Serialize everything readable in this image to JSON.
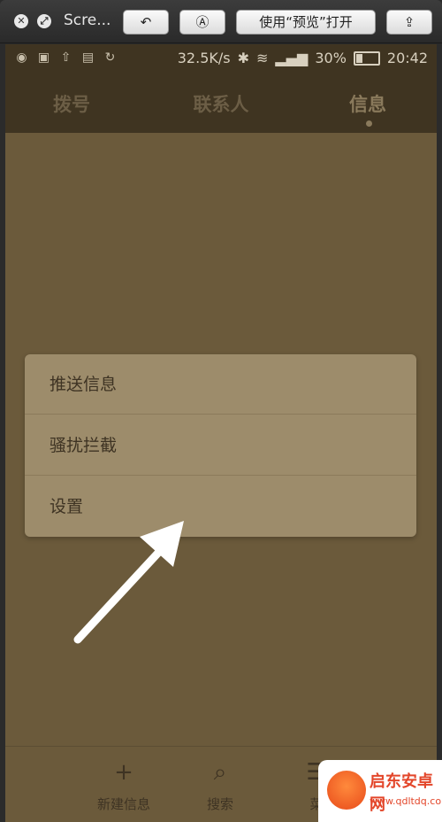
{
  "toolbar": {
    "title": "Scre...",
    "open_with_preview": "使用“预览”打开",
    "rotate_icon": "rotate-icon",
    "markup_icon": "markup-icon",
    "share_icon": "share-icon"
  },
  "statusbar": {
    "speed": "32.5K/s",
    "battery": "30%",
    "time": "20:42",
    "battery_level": 0.3
  },
  "tabs": [
    "拨号",
    "联系人",
    "信息"
  ],
  "active_tab": "信息",
  "menu": {
    "items": [
      "推送信息",
      "骚扰拦截",
      "设置"
    ]
  },
  "bottom_bar": {
    "items": [
      {
        "label": "新建信息",
        "icon": "plus-icon"
      },
      {
        "label": "搜索",
        "icon": "search-icon"
      },
      {
        "label": "菜",
        "icon": "menu-icon"
      }
    ]
  },
  "watermark": {
    "title": "启东安卓网",
    "url": "www.qdltdq.com"
  },
  "colors": {
    "background": "#6b5a3b",
    "statusbar": "#3f3421",
    "menu": "#9d8c6b"
  }
}
